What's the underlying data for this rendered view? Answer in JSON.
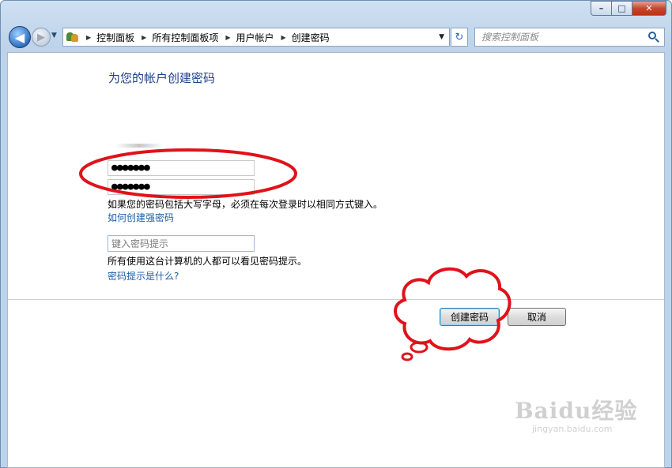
{
  "window": {
    "caption_buttons": {
      "minimize": "–",
      "maximize": "□",
      "close": "✕"
    }
  },
  "nav": {
    "back_glyph": "◀",
    "forward_glyph": "▶",
    "dropdown_glyph": "▼",
    "breadcrumb": [
      "控制面板",
      "所有控制面板项",
      "用户帐户",
      "创建密码"
    ],
    "breadcrumb_sep": "▶",
    "refresh_glyph": "↻",
    "search_placeholder": "搜索控制面板"
  },
  "page": {
    "title": "为您的帐户创建密码",
    "new_password_value": "●●●●●●●",
    "confirm_password_value": "●●●●●●●",
    "case_note": "如果您的密码包括大写字母，必须在每次登录时以相同方式键入。",
    "strong_password_link": "如何创建强密码",
    "hint_placeholder": "键入密码提示",
    "hint_note": "所有使用这台计算机的人都可以看见密码提示。",
    "hint_link": "密码提示是什么?"
  },
  "buttons": {
    "create": "创建密码",
    "cancel": "取消"
  },
  "watermark": {
    "logo": "Baidu经验",
    "url": "jingyan.baidu.com"
  },
  "colors": {
    "title_blue": "#1e3f8c",
    "link_blue": "#1c5fa6",
    "annotation_red": "#e0121a"
  },
  "icons": [
    "back-arrow-icon",
    "forward-arrow-icon",
    "control-panel-icon",
    "refresh-icon",
    "search-icon"
  ]
}
